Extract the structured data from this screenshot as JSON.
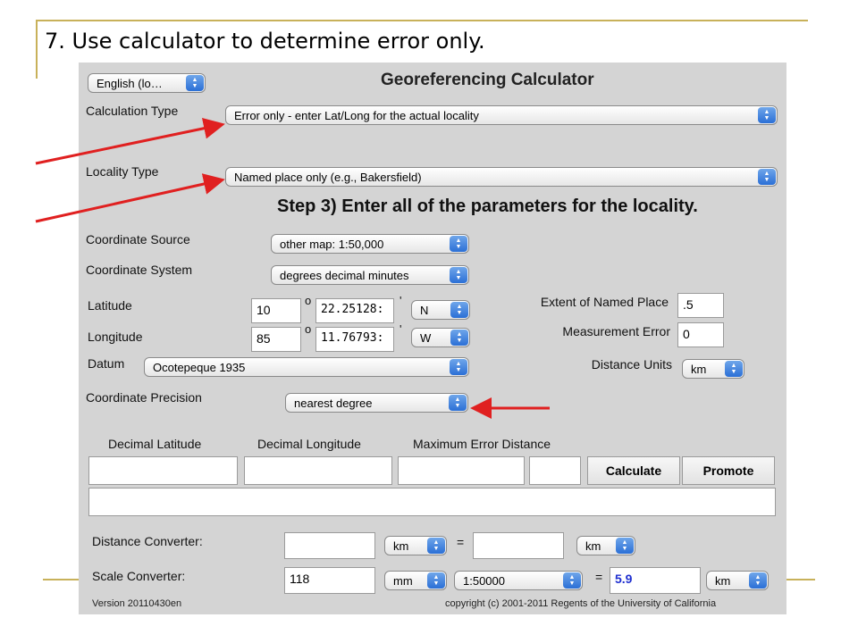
{
  "slide": {
    "title": "7. Use calculator to determine error only."
  },
  "calculator": {
    "language": "English (lo…",
    "title": "Georeferencing Calculator",
    "calculation_type": {
      "label": "Calculation Type",
      "value": "Error only - enter Lat/Long for the actual locality"
    },
    "locality_type": {
      "label": "Locality Type",
      "value": "Named place only (e.g., Bakersfield)"
    },
    "step_heading": "Step 3) Enter all of the parameters for the locality.",
    "coordinate_source": {
      "label": "Coordinate Source",
      "value": "other map: 1:50,000"
    },
    "coordinate_system": {
      "label": "Coordinate System",
      "value": "degrees decimal minutes"
    },
    "latitude": {
      "label": "Latitude",
      "degrees": "10",
      "minutes": "22.25128:",
      "direction": "N"
    },
    "longitude": {
      "label": "Longitude",
      "degrees": "85",
      "minutes": "11.76793:",
      "direction": "W"
    },
    "degree_symbol": "o",
    "minute_symbol": "'",
    "datum": {
      "label": "Datum",
      "value": "Ocotepeque 1935"
    },
    "coordinate_precision": {
      "label": "Coordinate Precision",
      "value": "nearest degree"
    },
    "extent": {
      "label": "Extent of Named Place",
      "value": ".5"
    },
    "measurement_error": {
      "label": "Measurement Error",
      "value": "0"
    },
    "distance_units": {
      "label": "Distance Units",
      "value": "km"
    },
    "results": {
      "decimal_latitude_label": "Decimal Latitude",
      "decimal_longitude_label": "Decimal Longitude",
      "max_error_label": "Maximum Error Distance",
      "decimal_latitude": "",
      "decimal_longitude": "",
      "max_error": "",
      "max_error_units": "",
      "calculate_button": "Calculate",
      "promote_button": "Promote",
      "output": ""
    },
    "distance_converter": {
      "label": "Distance Converter:",
      "from_value": "",
      "from_unit": "km",
      "equals": "=",
      "to_value": "",
      "to_unit": "km"
    },
    "scale_converter": {
      "label": "Scale Converter:",
      "value": "118",
      "unit": "mm",
      "scale": "1:50000",
      "equals": "=",
      "result": "5.9",
      "result_unit": "km"
    },
    "version": "Version 20110430en",
    "copyright": "copyright (c) 2001-2011 Regents of the University of California"
  },
  "annotation_color": "#e02020",
  "accent_color": "#c8b15a"
}
